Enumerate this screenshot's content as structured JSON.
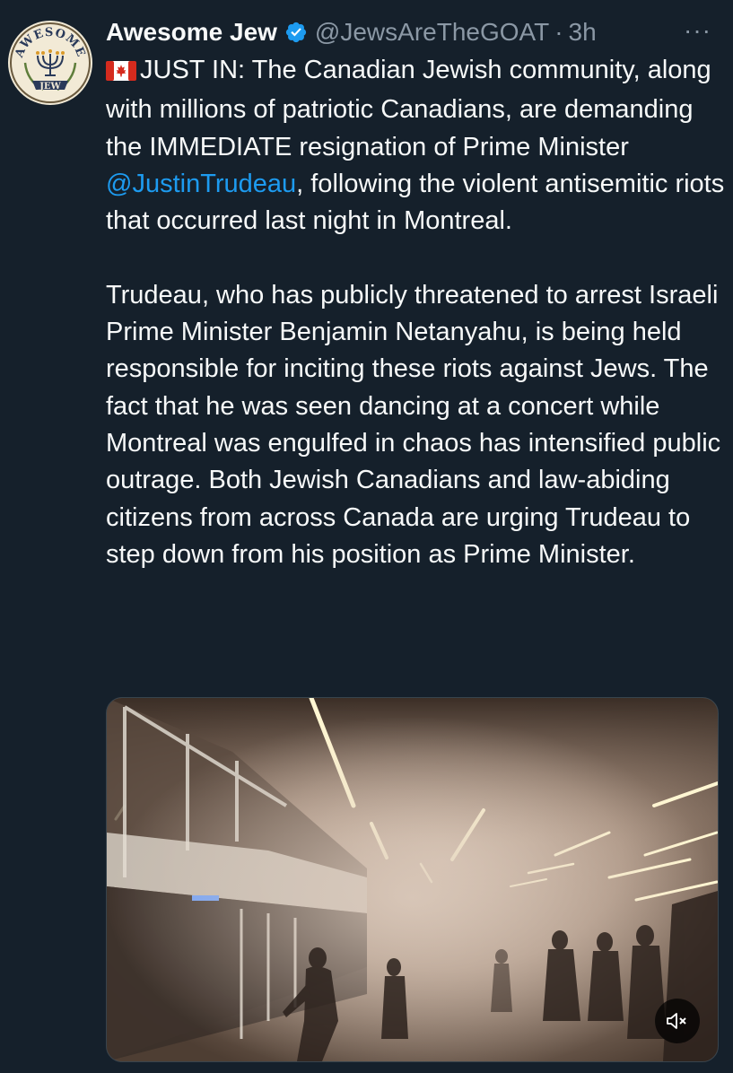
{
  "tweet": {
    "author": {
      "display_name": "Awesome Jew",
      "handle": "@JewsAreTheGOAT",
      "verified": true,
      "avatar_text_top": "AWESOME",
      "avatar_text_bottom": "JEW"
    },
    "separator": "·",
    "timestamp": "3h",
    "more_label": "···",
    "flag_icon": "canada-flag-icon",
    "paragraph1": {
      "before_mention": "JUST IN: The Canadian Jewish community, along with millions of patriotic Canadians, are demanding the IMMEDIATE resignation of Prime Minister ",
      "mention": "@JustinTrudeau",
      "after_mention": ", following the violent antisemitic riots that occurred last night in Montreal."
    },
    "paragraph2": "Trudeau, who has publicly threatened to arrest Israeli Prime Minister Benjamin Netanyahu, is being held responsible for inciting these riots against Jews. The fact that he was seen dancing at a concert while Montreal was engulfed in chaos has intensified public outrage. Both Jewish Canadians and law-abiding citizens from across Canada are urging Trudeau to step down from his position as Prime Minister.",
    "media": {
      "type": "video",
      "mute_icon": "speaker-muted-icon"
    }
  },
  "colors": {
    "background": "#15202b",
    "text": "#f7f9f9",
    "secondary": "#8b98a5",
    "link": "#1d9bf0",
    "verified": "#1d9bf0"
  }
}
